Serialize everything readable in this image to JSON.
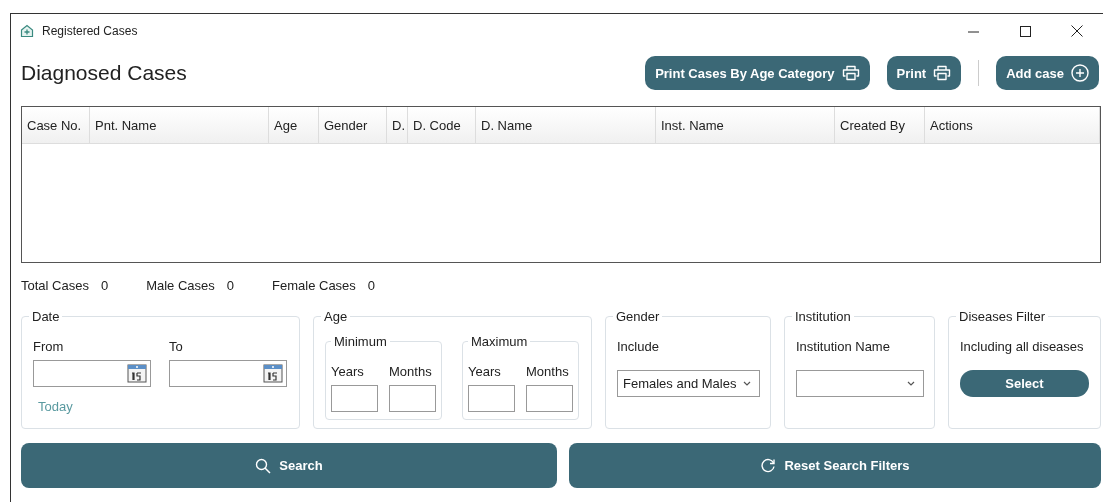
{
  "window": {
    "title": "Registered Cases"
  },
  "heading": "Diagnosed Cases",
  "toolbar": [
    {
      "label": "Print Cases By Age Category",
      "kind": "print"
    },
    {
      "label": "Print",
      "kind": "print"
    },
    {
      "label": "Add case",
      "kind": "add"
    }
  ],
  "table": {
    "columns": [
      "Case No.",
      "Pnt. Name",
      "Age",
      "Gender",
      "D.",
      "D. Code",
      "D. Name",
      "Inst. Name",
      "Created By",
      "Actions"
    ]
  },
  "summary": [
    {
      "label": "Total Cases",
      "value": "0"
    },
    {
      "label": "Male Cases",
      "value": "0"
    },
    {
      "label": "Female Cases",
      "value": "0"
    }
  ],
  "filters": [
    {
      "kind": "date",
      "title": "Date",
      "from_label": "From",
      "to_label": "To",
      "link": "Today"
    },
    {
      "kind": "age",
      "title": "Age",
      "groups": [
        {
          "title": "Minimum",
          "labels": [
            "Years",
            "Months"
          ]
        },
        {
          "title": "Maximum",
          "labels": [
            "Years",
            "Months"
          ]
        }
      ]
    },
    {
      "kind": "gender",
      "title": "Gender",
      "label": "Include",
      "value": "Females and Males"
    },
    {
      "kind": "institution",
      "title": "Institution",
      "label": "Institution Name"
    },
    {
      "kind": "diseases",
      "title": "Diseases Filter",
      "label": "Including all diseases",
      "button": "Select"
    }
  ],
  "actions": [
    {
      "label": "Search",
      "kind": "search"
    },
    {
      "label": "Reset Search Filters",
      "kind": "reset"
    }
  ]
}
